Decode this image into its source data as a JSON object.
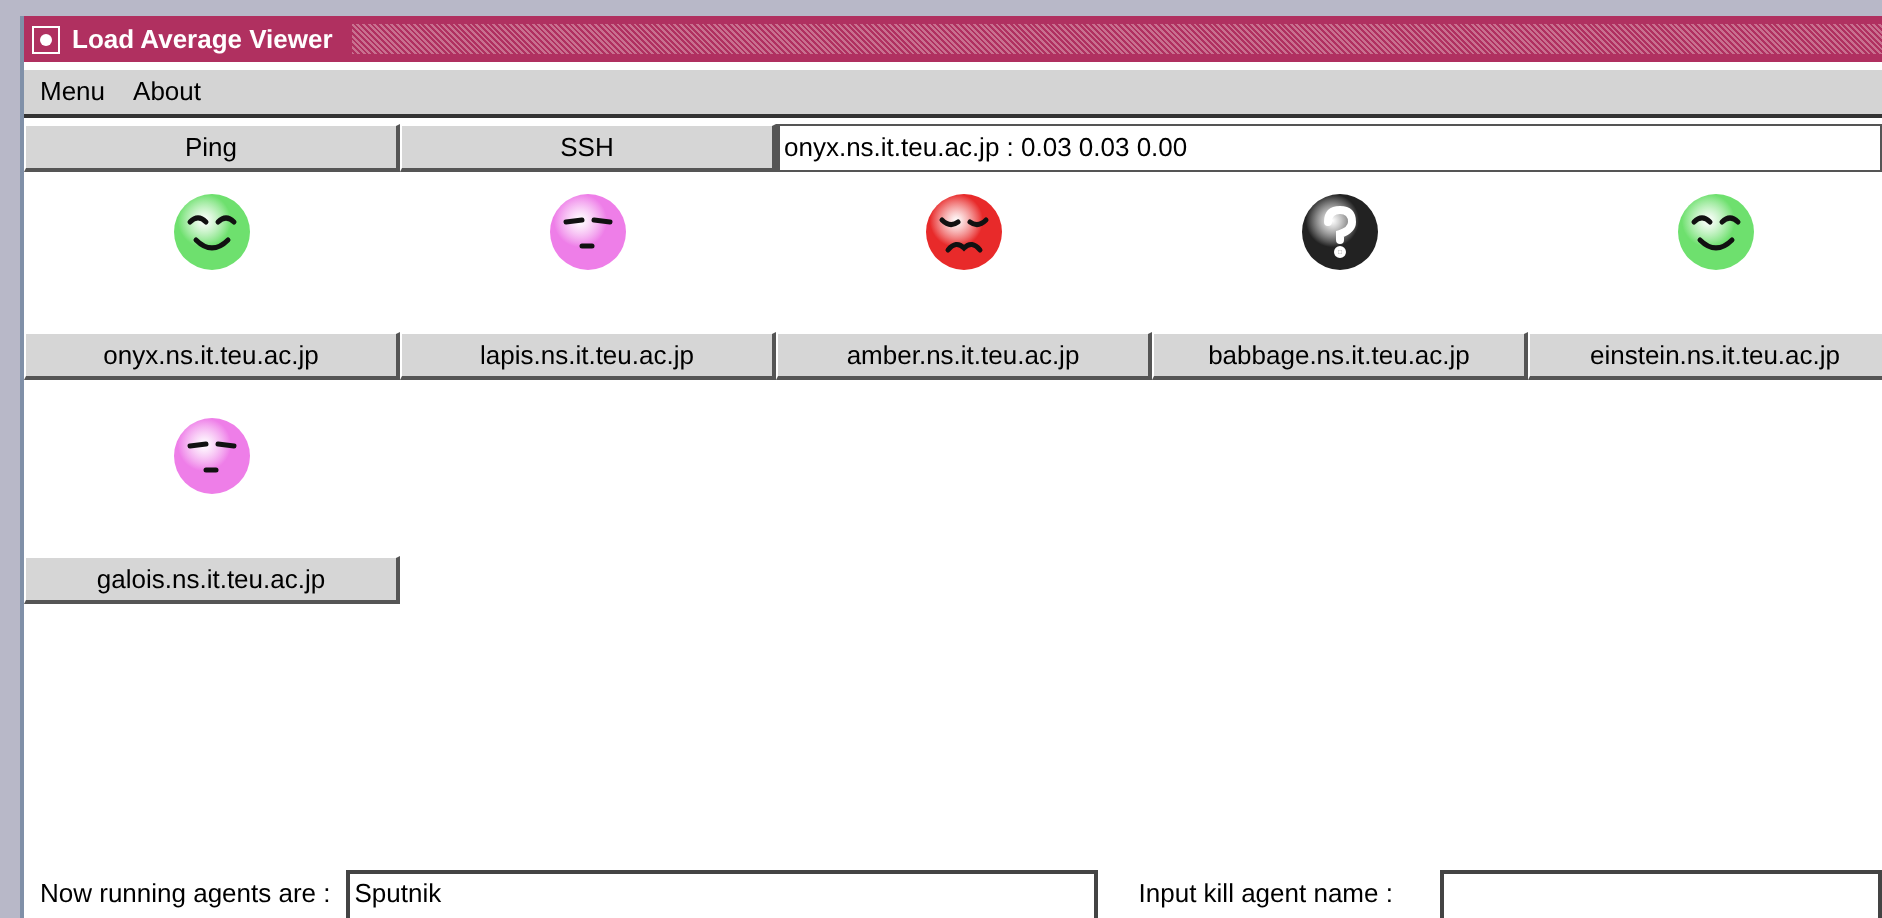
{
  "window": {
    "title": "Load Average Viewer"
  },
  "menu": [
    "Menu",
    "About"
  ],
  "toolbar": {
    "buttons": [
      "Ping",
      "SSH"
    ],
    "status": "onyx.ns.it.teu.ac.jp : 0.03 0.03 0.00"
  },
  "hosts": [
    {
      "name": "onyx.ns.it.teu.ac.jp",
      "kind": "happy"
    },
    {
      "name": "lapis.ns.it.teu.ac.jp",
      "kind": "sleepy"
    },
    {
      "name": "amber.ns.it.teu.ac.jp",
      "kind": "angry"
    },
    {
      "name": "babbage.ns.it.teu.ac.jp",
      "kind": "unknown"
    },
    {
      "name": "einstein.ns.it.teu.ac.jp",
      "kind": "happy"
    },
    {
      "name": "galois.ns.it.teu.ac.jp",
      "kind": "sleepy"
    }
  ],
  "footer": {
    "agents_label": "Now running agents are :",
    "agents_value": "Sputnik",
    "kill_label": "Input kill agent name :"
  }
}
